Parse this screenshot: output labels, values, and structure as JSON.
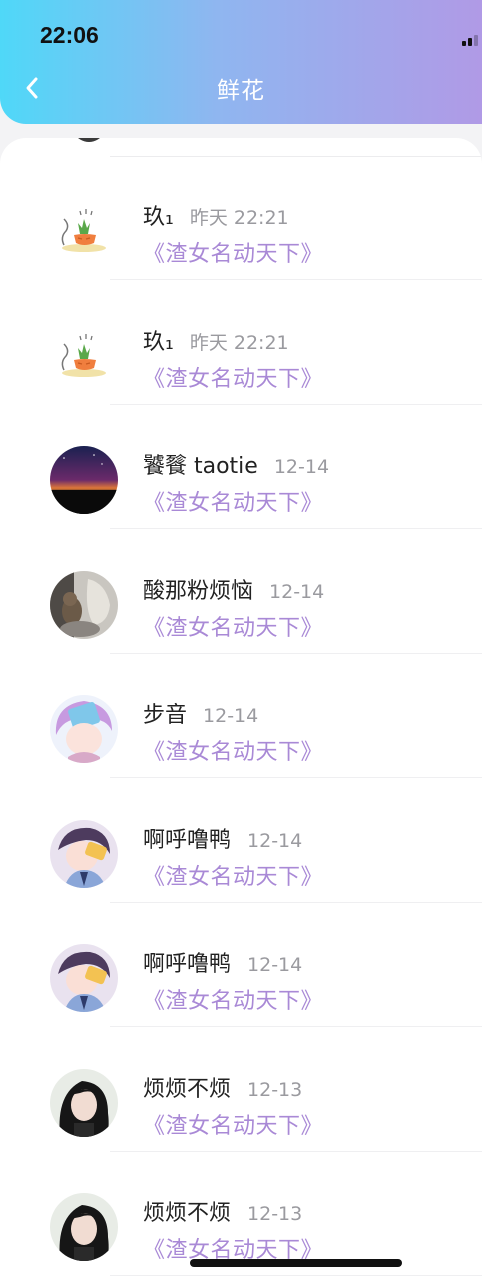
{
  "status_bar": {
    "time": "22:06"
  },
  "header": {
    "title": "鲜花",
    "back_icon": "chevron-left-icon"
  },
  "colors": {
    "accent_start": "#4fd8f8",
    "accent_end": "#b09ae6",
    "book_text": "#a989d6"
  },
  "list": {
    "items": [
      {
        "name": "玖₁",
        "time": "昨天 22:21",
        "book": "《渣女名动天下》",
        "avatar": "carrot-sketch"
      },
      {
        "name": "玖₁",
        "time": "昨天 22:21",
        "book": "《渣女名动天下》",
        "avatar": "carrot-sketch"
      },
      {
        "name": "饕餮 taotie",
        "time": "12-14",
        "book": "《渣女名动天下》",
        "avatar": "night-sky"
      },
      {
        "name": "酸那粉烦恼",
        "time": "12-14",
        "book": "《渣女名动天下》",
        "avatar": "cat-photo"
      },
      {
        "name": "步音",
        "time": "12-14",
        "book": "《渣女名动天下》",
        "avatar": "anime-girl-blue"
      },
      {
        "name": "啊呼噜鸭",
        "time": "12-14",
        "book": "《渣女名动天下》",
        "avatar": "anime-boy-pink"
      },
      {
        "name": "啊呼噜鸭",
        "time": "12-14",
        "book": "《渣女名动天下》",
        "avatar": "anime-boy-pink"
      },
      {
        "name": "烦烦不烦",
        "time": "12-13",
        "book": "《渣女名动天下》",
        "avatar": "girl-photo"
      },
      {
        "name": "烦烦不烦",
        "time": "12-13",
        "book": "《渣女名动天下》",
        "avatar": "girl-photo"
      }
    ]
  }
}
